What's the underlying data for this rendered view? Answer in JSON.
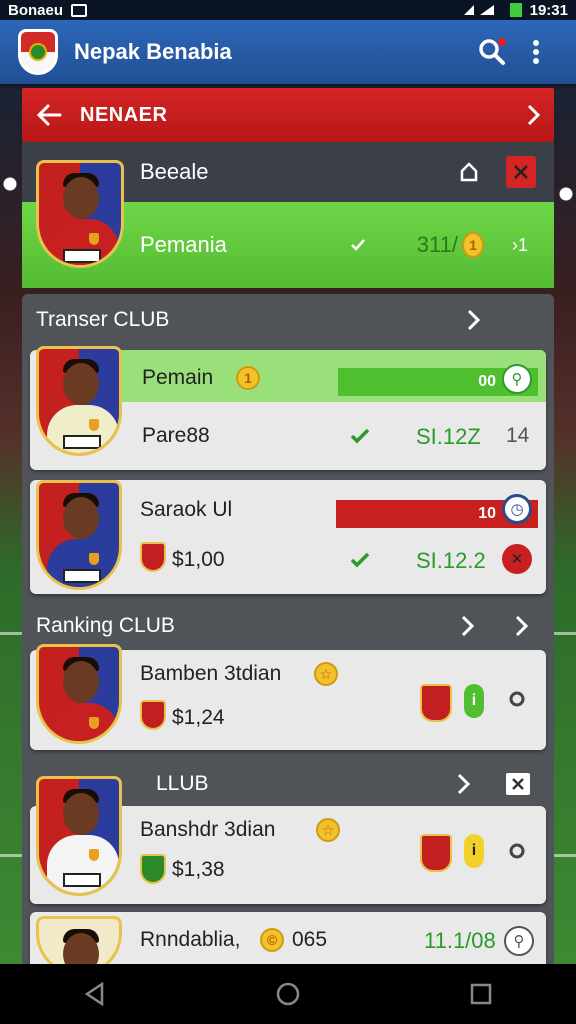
{
  "status_bar": {
    "carrier": "Bonaeu",
    "time": "19:31"
  },
  "app_bar": {
    "title": "Nepak Benabia"
  },
  "red_header": {
    "label": "NENAER"
  },
  "featured": {
    "name": "Beeale",
    "status": "Pemania",
    "value": "311/",
    "coin": "1",
    "extra": "›1"
  },
  "sections": [
    {
      "title": "Transer CLUB",
      "cards": [
        {
          "name": "Pemain",
          "coin": "1",
          "bar_value": "00",
          "sub": "Pare88",
          "price": "SI.12Z",
          "count": "14"
        },
        {
          "name": "Saraok Ul",
          "bar_value": "10",
          "money": "$1,00",
          "price": "SI.12.2"
        }
      ]
    },
    {
      "title": "Ranking CLUB",
      "cards": [
        {
          "name": "Bamben 3tdian",
          "money": "$1,24"
        }
      ]
    },
    {
      "title": "LLUB",
      "cards": [
        {
          "name": "Banshdr 3dian",
          "money": "$1,38"
        },
        {
          "name": "Rnndablia,",
          "coin_symbol": "©",
          "num": "065",
          "price": "11.1/08"
        }
      ]
    }
  ],
  "colors": {
    "appbar": "#2d67b8",
    "red": "#d42424",
    "green": "#55bb33",
    "panel": "#505459",
    "card": "#e9e9e9"
  }
}
